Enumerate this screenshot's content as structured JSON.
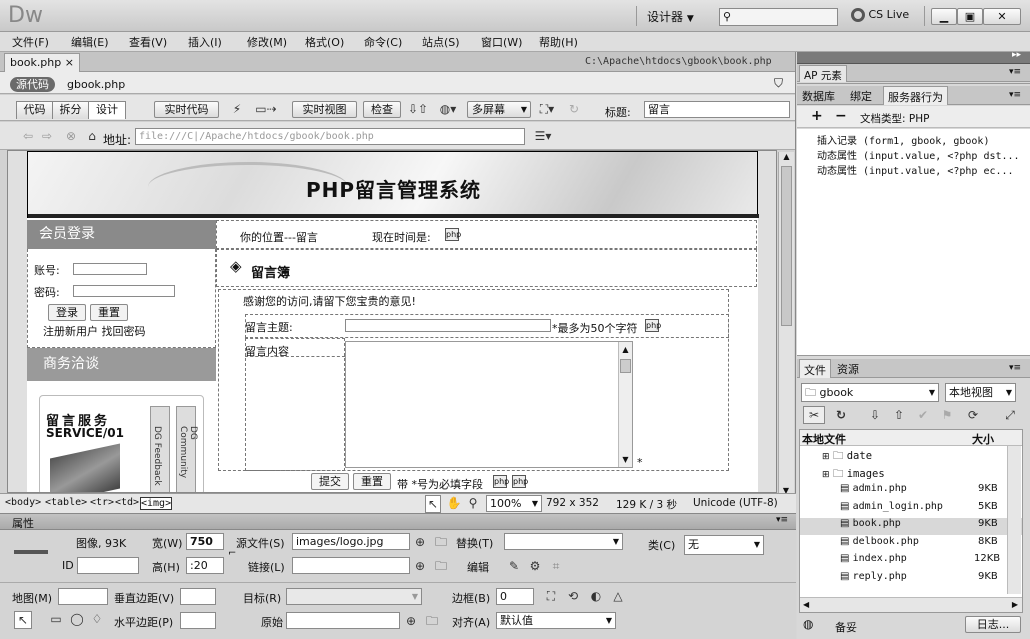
{
  "app": {
    "logo": "Dw",
    "workspace": "设计器",
    "search_placeholder": "",
    "cslive": "CS Live"
  },
  "menu": [
    "文件(F)",
    "编辑(E)",
    "查看(V)",
    "插入(I)",
    "修改(M)",
    "格式(O)",
    "命令(C)",
    "站点(S)",
    "窗口(W)",
    "帮助(H)"
  ],
  "doc": {
    "tab": "book.php",
    "path": "C:\\Apache\\htdocs\\gbook\\book.php",
    "source_badge": "源代码",
    "related_file": "gbook.php"
  },
  "toolbar": {
    "code": "代码",
    "split": "拆分",
    "design": "设计",
    "live_code": "实时代码",
    "live_view": "实时视图",
    "inspect": "检查",
    "multiscreen": "多屏幕",
    "title_label": "标题:",
    "title_value": "留言"
  },
  "browser": {
    "address_label": "地址:",
    "address": "file:///C|/Apache/htdocs/gbook/book.php"
  },
  "site": {
    "banner": "PHP留言管理系统",
    "member_login": "会员登录",
    "account": "账号:",
    "password": "密码:",
    "login_btn": "登录",
    "reset_btn": "重置",
    "register": "注册新用户 找回密码",
    "business": "商务洽谈",
    "promo_line1": "留言服务",
    "promo_line2": "SERVICE/01",
    "promo_v1": "DG Feedback",
    "promo_v2": "DG Community",
    "location": "你的位置---留言",
    "now_time": "现在时间是:",
    "guestbook": "留言簿",
    "thanks": "感谢您的访问,请留下您宝贵的意见!",
    "subject_label": "留言主题:",
    "subject_hint": "*最多为50个字符",
    "content_label": "留言内容",
    "submit": "提交",
    "reset": "重置",
    "required_note": "带 *号为必填字段",
    "star": "*"
  },
  "status": {
    "tags": [
      "<body>",
      "<table>",
      "<tr>",
      "<td>",
      "<img>"
    ],
    "zoom": "100%",
    "size": "792 x 352",
    "weight": "129 K / 3 秒",
    "encoding": "Unicode (UTF-8)"
  },
  "props": {
    "title": "属性",
    "image_label": "图像, 93K",
    "width_label": "宽(W)",
    "width": "750",
    "height_label": "高(H)",
    "height": ":20",
    "src_label": "源文件(S)",
    "src": "images/logo.jpg",
    "link_label": "链接(L)",
    "alt_label": "替换(T)",
    "edit_label": "编辑",
    "class_label": "类(C)",
    "class_value": "无",
    "id_label": "ID",
    "map_label": "地图(M)",
    "vspace_label": "垂直边距(V)",
    "hspace_label": "水平边距(P)",
    "target_label": "目标(R)",
    "original_label": "原始",
    "border_label": "边框(B)",
    "border": "0",
    "align_label": "对齐(A)",
    "align_value": "默认值"
  },
  "panels": {
    "ap_tab": "AP 元素",
    "tabs": [
      "数据库",
      "绑定",
      "服务器行为"
    ],
    "doctype": "文档类型: PHP",
    "behaviors": [
      {
        "name": "插入记录",
        "args": "(form1, gbook, gbook)"
      },
      {
        "name": "动态属性",
        "args": "(input.value, <?php dst..."
      },
      {
        "name": "动态属性",
        "args": "(input.value, <?php ec..."
      }
    ],
    "files_tabs": [
      "文件",
      "资源"
    ],
    "site_name": "gbook",
    "view": "本地视图",
    "col_local": "本地文件",
    "col_size": "大小",
    "files": [
      {
        "name": "date",
        "size": "",
        "folder": true
      },
      {
        "name": "images",
        "size": "",
        "folder": true
      },
      {
        "name": "admin.php",
        "size": "9KB"
      },
      {
        "name": "admin_login.php",
        "size": "5KB"
      },
      {
        "name": "book.php",
        "size": "9KB"
      },
      {
        "name": "delbook.php",
        "size": "8KB"
      },
      {
        "name": "index.php",
        "size": "12KB"
      },
      {
        "name": "reply.php",
        "size": "9KB"
      }
    ],
    "ready": "备妥",
    "log": "日志..."
  }
}
